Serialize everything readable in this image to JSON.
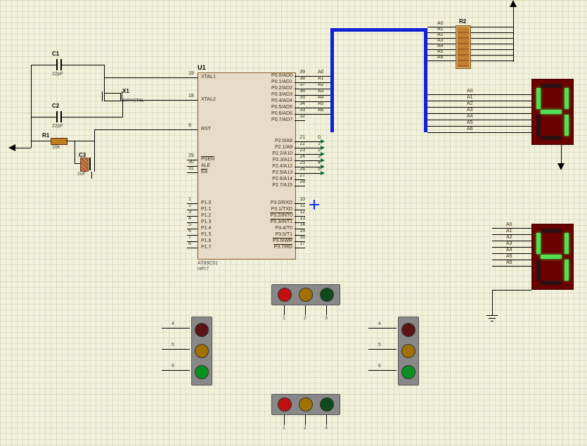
{
  "mcu": {
    "ref": "U1",
    "part": "AT89C51",
    "note": "ref=7",
    "left": [
      {
        "num": "19",
        "name": "XTAL1"
      },
      {
        "num": "18",
        "name": "XTAL2"
      },
      {
        "num": "9",
        "name": "RST"
      },
      {
        "num": "29",
        "name": "PSEN",
        "bar": true
      },
      {
        "num": "30",
        "name": "ALE"
      },
      {
        "num": "31",
        "name": "EA",
        "bar": true
      },
      {
        "num": "1",
        "name": "P1.0"
      },
      {
        "num": "2",
        "name": "P1.1"
      },
      {
        "num": "3",
        "name": "P1.2"
      },
      {
        "num": "4",
        "name": "P1.3"
      },
      {
        "num": "5",
        "name": "P1.4"
      },
      {
        "num": "6",
        "name": "P1.5"
      },
      {
        "num": "7",
        "name": "P1.6"
      },
      {
        "num": "8",
        "name": "P1.7"
      }
    ],
    "right": [
      {
        "num": "39",
        "name": "P0.0/AD0"
      },
      {
        "num": "38",
        "name": "P0.1/AD1"
      },
      {
        "num": "37",
        "name": "P0.2/AD2"
      },
      {
        "num": "36",
        "name": "P0.3/AD3"
      },
      {
        "num": "35",
        "name": "P0.4/AD4"
      },
      {
        "num": "34",
        "name": "P0.5/AD5"
      },
      {
        "num": "33",
        "name": "P0.6/AD6"
      },
      {
        "num": "32",
        "name": "P0.7/AD7"
      },
      {
        "num": "21",
        "name": "P2.0/A8"
      },
      {
        "num": "22",
        "name": "P2.1/A9"
      },
      {
        "num": "23",
        "name": "P2.2/A10"
      },
      {
        "num": "24",
        "name": "P2.3/A11"
      },
      {
        "num": "25",
        "name": "P2.4/A12"
      },
      {
        "num": "26",
        "name": "P2.5/A13"
      },
      {
        "num": "27",
        "name": "P2.6/A14"
      },
      {
        "num": "28",
        "name": "P2.7/A15"
      },
      {
        "num": "10",
        "name": "P3.0/RXD"
      },
      {
        "num": "11",
        "name": "P3.1/TXD"
      },
      {
        "num": "12",
        "name": "P3.2/INT0",
        "bar": true
      },
      {
        "num": "13",
        "name": "P3.3/INT1",
        "bar": true
      },
      {
        "num": "14",
        "name": "P3.4/T0"
      },
      {
        "num": "15",
        "name": "P3.5/T1"
      },
      {
        "num": "16",
        "name": "P3.6/WR",
        "bar": true
      },
      {
        "num": "17",
        "name": "P3.7/RD",
        "bar": true
      }
    ]
  },
  "components": {
    "C1": {
      "ref": "C1",
      "val": "22pF"
    },
    "C2": {
      "ref": "C2",
      "val": "22pF"
    },
    "C3": {
      "ref": "C3",
      "val": "1uF"
    },
    "R1": {
      "ref": "R1",
      "val": "10k"
    },
    "R2": {
      "ref": "R2"
    },
    "X1": {
      "ref": "X1",
      "val": "CRYSTAL"
    }
  },
  "nets": {
    "P0": [
      "A0",
      "A1",
      "A2",
      "A3",
      "A4",
      "A5",
      "A6"
    ],
    "P2": [
      "0",
      "1",
      "2",
      "3",
      "4",
      "5"
    ],
    "R2pins_left": [
      "A0",
      "A1",
      "A2",
      "A3",
      "A4",
      "A5",
      "A6"
    ],
    "disp_pins": [
      "A0",
      "A1",
      "A2",
      "A3",
      "A4",
      "A5",
      "A6"
    ]
  },
  "traffic_lights": {
    "top": {
      "orientation": "horizontal",
      "leds": [
        "red",
        "yel",
        "dgrn"
      ],
      "pins": [
        "1",
        "2",
        "3"
      ]
    },
    "bottom": {
      "orientation": "horizontal",
      "leds": [
        "red",
        "yel",
        "dgrn"
      ],
      "pins": [
        "1",
        "2",
        "3"
      ]
    },
    "left": {
      "orientation": "vertical",
      "leds": [
        "dred",
        "yel",
        "grn"
      ],
      "pins": [
        "4",
        "5",
        "6"
      ]
    },
    "right": {
      "orientation": "vertical",
      "leds": [
        "dred",
        "yel",
        "grn"
      ],
      "pins": [
        "4",
        "5",
        "6"
      ]
    }
  },
  "seven_seg": {
    "digit": "4",
    "disp1_segments": {
      "a": false,
      "b": true,
      "c": true,
      "d": false,
      "e": false,
      "f": true,
      "g": true
    },
    "disp2_segments": {
      "a": false,
      "b": true,
      "c": true,
      "d": false,
      "e": false,
      "f": true,
      "g": true
    }
  },
  "chart_data": null
}
